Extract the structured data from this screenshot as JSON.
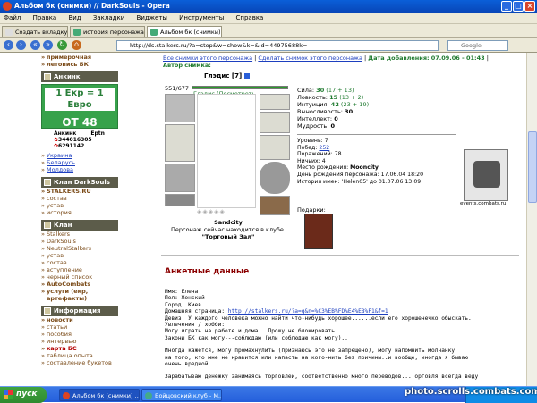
{
  "window": {
    "title": "Альбом бк (снимки) // DarkSouls - Opera"
  },
  "menu": [
    "Файл",
    "Правка",
    "Вид",
    "Закладки",
    "Виджеты",
    "Инструменты",
    "Справка"
  ],
  "tabs": [
    {
      "label": "Создать вкладку",
      "active": false
    },
    {
      "label": "история персонажа БК ...",
      "active": false
    },
    {
      "label": "Альбом бк (снимки) // D...",
      "active": true
    }
  ],
  "address": {
    "url": "http://ds.stalkers.ru/?a=stop&w=show&k=&id=44975688k=",
    "search_placeholder": "Google"
  },
  "sidebar": {
    "top_items": [
      "примерочная",
      "летопись БК"
    ],
    "antimag_header": "Анкинк",
    "banner": {
      "line1": "1 Екр = 1 Евро",
      "line2": "ОТ 48 ЧАСОВ"
    },
    "contacts": {
      "name1": "Анкинк",
      "name2": "Eptn",
      "icq1": "344016305",
      "icq2": "6291142"
    },
    "countries": [
      "Украина",
      "Беларусь",
      "Молдова"
    ],
    "clan_darksouls_header": "Клан DarkSouls",
    "clan_darksouls_items": [
      "STALKERS.RU",
      "состав",
      "устав",
      "история"
    ],
    "clan_header": "Клан",
    "clan_items": [
      "Stalkers",
      "DarkSouls",
      "NeutralStalkers",
      "устав",
      "состав",
      "вступление",
      "черный список",
      "AutoCombats",
      "услуги (екр, артефакты)"
    ],
    "info_header": "Информация",
    "info_items": [
      "новости",
      "статьи",
      "пособия",
      "интервью",
      "карта БС",
      "таблица опыта",
      "составление букетов"
    ]
  },
  "main": {
    "top_links": {
      "all": "Все снимки этого персонажа",
      "make": "Сделать снимок этого персонажа",
      "date_label": "Дата добавления:",
      "date": "07.09.06 - 01:43"
    },
    "author_label": "Автор снимка:",
    "char_name": "Глэдис",
    "char_level": "[7]",
    "hp": "551/677",
    "look_link": "Глэдис (Посмотреть",
    "stats": [
      {
        "label": "Сила:",
        "value": "30",
        "extra": "(17 + 13)"
      },
      {
        "label": "Ловкость:",
        "value": "15",
        "extra": "(13 + 2)"
      },
      {
        "label": "Интуиция:",
        "value": "42",
        "extra": "(23 + 19)"
      },
      {
        "label": "Выносливость:",
        "value": "30",
        "extra": ""
      },
      {
        "label": "Интеллект:",
        "value": "0",
        "extra": ""
      },
      {
        "label": "Мудрость:",
        "value": "0",
        "extra": ""
      }
    ],
    "info": [
      {
        "label": "Уровень:",
        "value": "7"
      },
      {
        "label": "Побед:",
        "value": "252"
      },
      {
        "label": "Поражений:",
        "value": "78"
      },
      {
        "label": "Ничьих:",
        "value": "4"
      },
      {
        "label": "Место рождения:",
        "value": "Mooncity"
      },
      {
        "label": "День рождения персонажа:",
        "value": "17.06.04 18:20"
      },
      {
        "label": "История имен:",
        "value": "'Helen05' до 01.07.06 13:09"
      }
    ],
    "city": "Sandcity",
    "location_text": "Персонаж сейчас находится в клубе.",
    "location_room": "\"Торговый Зал\"",
    "gifts_label": "Подарки:",
    "emblem_caption": "events.combats.ru",
    "profile_title": "Анкетные данные",
    "profile": {
      "name": "Имя: Елена",
      "sex": "Пол: Женский",
      "city": "Город: Киев",
      "home_label": "Домашняя страница:",
      "home_url": "http://stalkers.ru/?a=q&n=%C3%EB%FD%E4%E8%F1&f=1",
      "motto": "Девиз: У каждого человека можно найти что-нибудь хорошее......если его хорошенечко обыскать..",
      "hobby_label": "Увлечения / хобби:",
      "hobby1": "Могу играть на работе и дома...Прошу не блокировать..",
      "hobby2": "Законы БК как могу---соблюдаю (или соблюдаю как могу)..",
      "text1": "Иногда кажется, могу промахнулить (признаюсь это не запрещено), могу напомнить молчанку",
      "text2": "на того, кто мне не нравится или напасть на кого-нить без причины..и вообще, иногда я бываю",
      "text3": "очень вредной...",
      "text4": "Зарабатываю денежку занимаясь торговлей, соответственно много переводов...Торговля всегда веду"
    }
  },
  "taskbar": {
    "start": "пуск",
    "buttons": [
      {
        "label": "Альбом бк (снимки) ..."
      },
      {
        "label": "Бойцовский клуб - M..."
      }
    ],
    "watermark": "photo.scrolls.combats.com"
  }
}
